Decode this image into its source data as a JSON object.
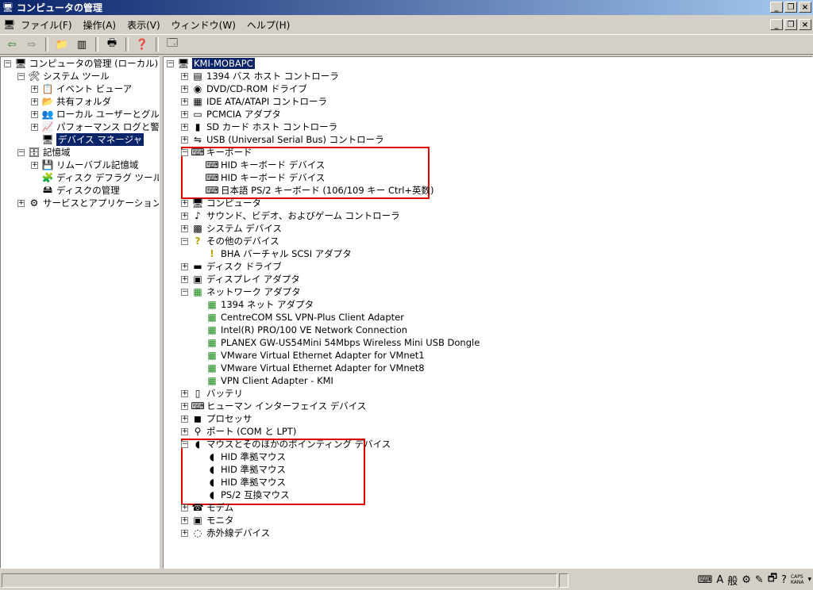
{
  "window": {
    "title": "コンピュータの管理"
  },
  "menu": [
    "ファイル(F)",
    "操作(A)",
    "表示(V)",
    "ウィンドウ(W)",
    "ヘルプ(H)"
  ],
  "left_tree": [
    {
      "label": "コンピュータの管理 (ローカル)",
      "level": 0,
      "expander": "minus",
      "icon": "computer-icon"
    },
    {
      "label": "システム ツール",
      "level": 1,
      "expander": "minus",
      "icon": "tools-icon"
    },
    {
      "label": "イベント ビューア",
      "level": 2,
      "expander": "plus",
      "icon": "event-viewer-icon"
    },
    {
      "label": "共有フォルダ",
      "level": 2,
      "expander": "plus",
      "icon": "shared-folder-icon"
    },
    {
      "label": "ローカル ユーザーとグループ",
      "level": 2,
      "expander": "plus",
      "icon": "users-icon"
    },
    {
      "label": "パフォーマンス ログと警告",
      "level": 2,
      "expander": "plus",
      "icon": "performance-icon"
    },
    {
      "label": "デバイス マネージャ",
      "level": 2,
      "expander": "none",
      "icon": "device-manager-icon",
      "selected": true
    },
    {
      "label": "記憶域",
      "level": 1,
      "expander": "minus",
      "icon": "storage-icon"
    },
    {
      "label": "リムーバブル記憶域",
      "level": 2,
      "expander": "plus",
      "icon": "removable-storage-icon"
    },
    {
      "label": "ディスク デフラグ ツール",
      "level": 2,
      "expander": "none",
      "icon": "defrag-icon"
    },
    {
      "label": "ディスクの管理",
      "level": 2,
      "expander": "none",
      "icon": "disk-management-icon"
    },
    {
      "label": "サービスとアプリケーション",
      "level": 1,
      "expander": "plus",
      "icon": "services-icon"
    }
  ],
  "right_tree": [
    {
      "label": "KMI-MOBAPC",
      "level": 0,
      "expander": "minus",
      "icon": "computer-icon",
      "selected": true
    },
    {
      "label": "1394 バス ホスト コントローラ",
      "level": 1,
      "expander": "plus",
      "icon": "controller-icon"
    },
    {
      "label": "DVD/CD-ROM ドライブ",
      "level": 1,
      "expander": "plus",
      "icon": "cdrom-icon"
    },
    {
      "label": "IDE ATA/ATAPI コントローラ",
      "level": 1,
      "expander": "plus",
      "icon": "ide-icon"
    },
    {
      "label": "PCMCIA アダプタ",
      "level": 1,
      "expander": "plus",
      "icon": "pcmcia-icon"
    },
    {
      "label": "SD カード ホスト コントローラ",
      "level": 1,
      "expander": "plus",
      "icon": "sd-card-icon"
    },
    {
      "label": "USB (Universal Serial Bus) コントローラ",
      "level": 1,
      "expander": "plus",
      "icon": "usb-icon"
    },
    {
      "label": "キーボード",
      "level": 1,
      "expander": "minus",
      "icon": "keyboard-icon"
    },
    {
      "label": "HID キーボード デバイス",
      "level": 2,
      "expander": "none",
      "icon": "keyboard-icon"
    },
    {
      "label": "HID キーボード デバイス",
      "level": 2,
      "expander": "none",
      "icon": "keyboard-icon"
    },
    {
      "label": "日本語 PS/2 キーボード (106/109 キー Ctrl+英数)",
      "level": 2,
      "expander": "none",
      "icon": "keyboard-icon"
    },
    {
      "label": "コンピュータ",
      "level": 1,
      "expander": "plus",
      "icon": "computer-icon"
    },
    {
      "label": "サウンド、ビデオ、およびゲーム コントローラ",
      "level": 1,
      "expander": "plus",
      "icon": "sound-icon"
    },
    {
      "label": "システム デバイス",
      "level": 1,
      "expander": "plus",
      "icon": "system-device-icon"
    },
    {
      "label": "その他のデバイス",
      "level": 1,
      "expander": "minus",
      "icon": "unknown-device-icon"
    },
    {
      "label": "BHA バーチャル SCSI アダプタ",
      "level": 2,
      "expander": "none",
      "icon": "warning-device-icon"
    },
    {
      "label": "ディスク ドライブ",
      "level": 1,
      "expander": "plus",
      "icon": "disk-drive-icon"
    },
    {
      "label": "ディスプレイ アダプタ",
      "level": 1,
      "expander": "plus",
      "icon": "display-adapter-icon"
    },
    {
      "label": "ネットワーク アダプタ",
      "level": 1,
      "expander": "minus",
      "icon": "network-adapter-icon"
    },
    {
      "label": "1394 ネット アダプタ",
      "level": 2,
      "expander": "none",
      "icon": "network-adapter-icon"
    },
    {
      "label": "CentreCOM SSL VPN-Plus Client Adapter",
      "level": 2,
      "expander": "none",
      "icon": "network-adapter-icon"
    },
    {
      "label": "Intel(R) PRO/100 VE Network Connection",
      "level": 2,
      "expander": "none",
      "icon": "network-adapter-icon"
    },
    {
      "label": "PLANEX GW-US54Mini 54Mbps Wireless Mini USB Dongle",
      "level": 2,
      "expander": "none",
      "icon": "network-adapter-icon"
    },
    {
      "label": "VMware Virtual Ethernet Adapter for VMnet1",
      "level": 2,
      "expander": "none",
      "icon": "network-adapter-icon"
    },
    {
      "label": "VMware Virtual Ethernet Adapter for VMnet8",
      "level": 2,
      "expander": "none",
      "icon": "network-adapter-icon"
    },
    {
      "label": "VPN Client Adapter - KMI",
      "level": 2,
      "expander": "none",
      "icon": "network-adapter-icon"
    },
    {
      "label": "バッテリ",
      "level": 1,
      "expander": "plus",
      "icon": "battery-icon"
    },
    {
      "label": "ヒューマン インターフェイス デバイス",
      "level": 1,
      "expander": "plus",
      "icon": "hid-icon"
    },
    {
      "label": "プロセッサ",
      "level": 1,
      "expander": "plus",
      "icon": "processor-icon"
    },
    {
      "label": "ポート (COM と LPT)",
      "level": 1,
      "expander": "plus",
      "icon": "port-icon"
    },
    {
      "label": "マウスとそのほかのポインティング デバイス",
      "level": 1,
      "expander": "minus",
      "icon": "mouse-icon"
    },
    {
      "label": "HID 準拠マウス",
      "level": 2,
      "expander": "none",
      "icon": "mouse-icon"
    },
    {
      "label": "HID 準拠マウス",
      "level": 2,
      "expander": "none",
      "icon": "mouse-icon"
    },
    {
      "label": "HID 準拠マウス",
      "level": 2,
      "expander": "none",
      "icon": "mouse-icon"
    },
    {
      "label": "PS/2 互換マウス",
      "level": 2,
      "expander": "none",
      "icon": "mouse-icon"
    },
    {
      "label": "モデム",
      "level": 1,
      "expander": "plus",
      "icon": "modem-icon"
    },
    {
      "label": "モニタ",
      "level": 1,
      "expander": "plus",
      "icon": "monitor-icon"
    },
    {
      "label": "赤外線デバイス",
      "level": 1,
      "expander": "plus",
      "icon": "infrared-icon"
    }
  ],
  "status_tray": {
    "ime_mode": "A",
    "ime_kanji": "般",
    "caps": "CAPS",
    "kana": "KANA"
  }
}
